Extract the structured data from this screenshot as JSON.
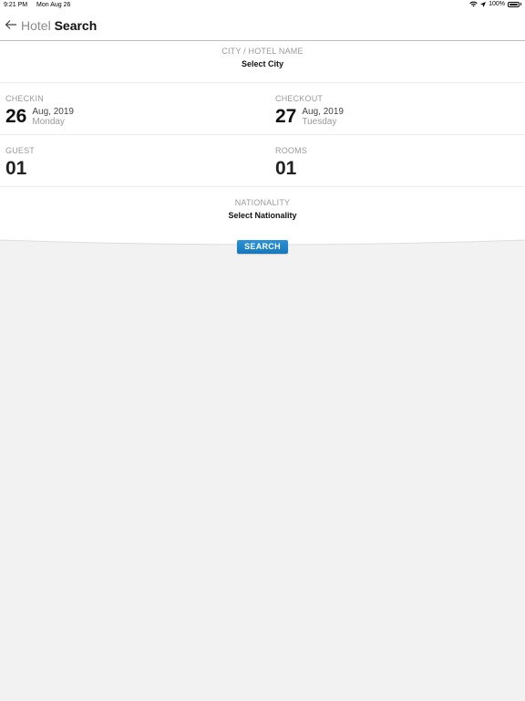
{
  "status_bar": {
    "time": "9:21 PM",
    "date": "Mon Aug 26",
    "battery": "100%",
    "icons": [
      "wifi-icon",
      "location-icon",
      "battery-icon"
    ]
  },
  "header": {
    "back_icon": "arrow-left-icon",
    "title_light": "Hotel",
    "title_bold": "Search"
  },
  "form": {
    "city": {
      "label": "CITY / HOTEL NAME",
      "value": "Select City"
    },
    "checkin": {
      "label": "CHECKIN",
      "day": "26",
      "month_year": "Aug, 2019",
      "weekday": "Monday"
    },
    "checkout": {
      "label": "CHECKOUT",
      "day": "27",
      "month_year": "Aug, 2019",
      "weekday": "Tuesday"
    },
    "guest": {
      "label": "GUEST",
      "value": "01"
    },
    "rooms": {
      "label": "ROOMS",
      "value": "01"
    },
    "nationality": {
      "label": "NATIONALITY",
      "value": "Select Nationality"
    }
  },
  "search_button": {
    "label": "SEARCH"
  },
  "colors": {
    "accent": "#1a82c8",
    "background": "#f2f2f2",
    "card": "#ffffff"
  }
}
